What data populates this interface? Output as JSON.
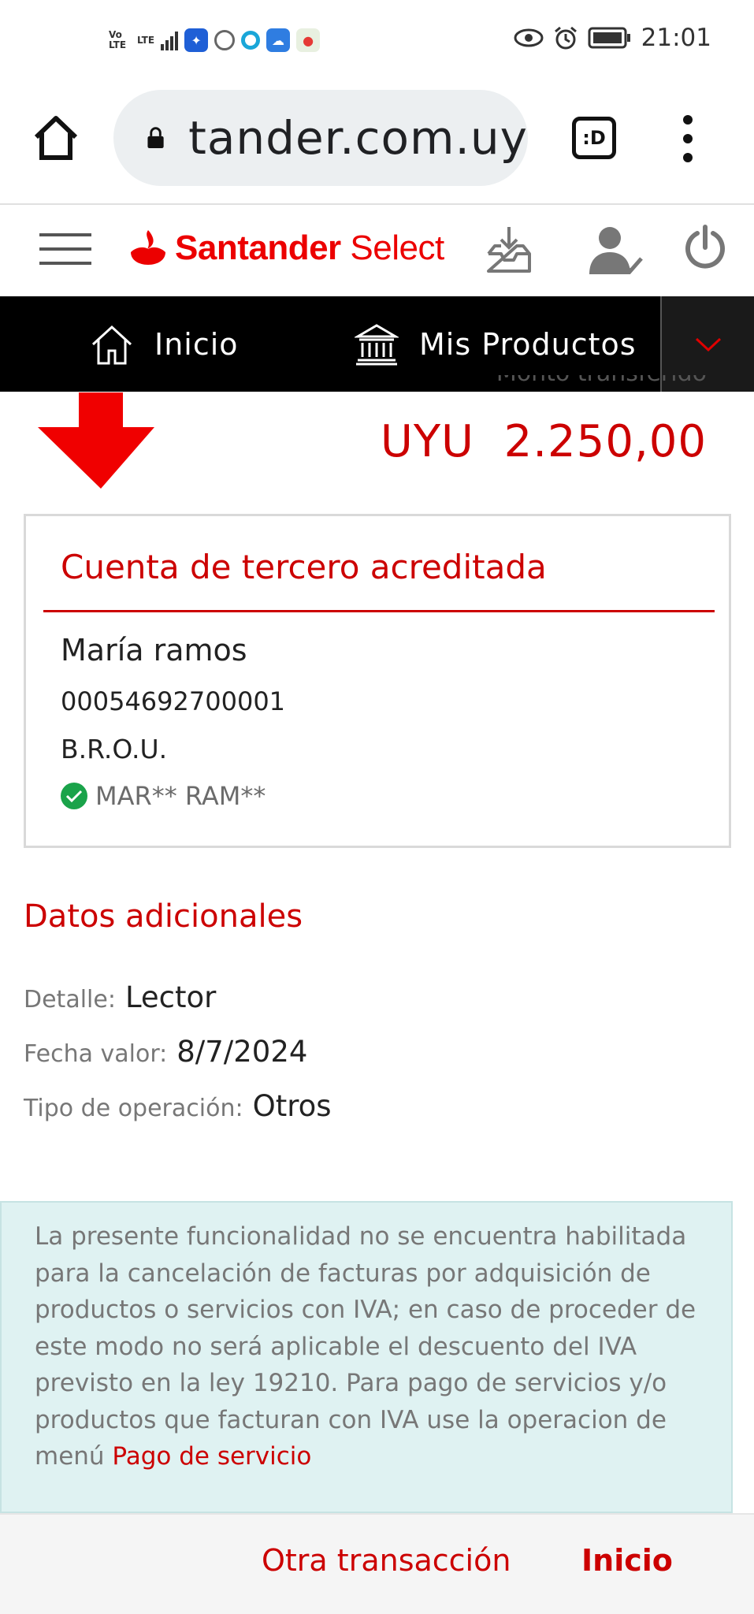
{
  "status_bar": {
    "network_1": "Vo LTE",
    "network_2": "LTE",
    "time": "21:01",
    "icons": [
      "signal-bars-icon",
      "lightbulb-app-icon",
      "camera-app-icon",
      "chat-app-icon",
      "cloud-app-icon",
      "maps-app-icon",
      "eye-icon",
      "alarm-icon",
      "battery-icon"
    ]
  },
  "browser": {
    "url": "tander.com.uy",
    "tab_label": ":D"
  },
  "header": {
    "brand_main": "Santander",
    "brand_sub": " Select",
    "brand_color": "#ec0000"
  },
  "nav": {
    "items": [
      {
        "label": "Inicio",
        "icon": "house-icon"
      },
      {
        "label": "Mis Productos",
        "icon": "bank-icon"
      }
    ]
  },
  "transfer": {
    "amount_label": "Monto transferido",
    "currency": "UYU",
    "amount": "2.250,00"
  },
  "card": {
    "title": "Cuenta de tercero acreditada",
    "name": "María ramos",
    "account": "00054692700001",
    "bank": "B.R.O.U.",
    "verified_name": "MAR** RAM**"
  },
  "additional": {
    "title": "Datos adicionales",
    "rows": [
      {
        "label": "Detalle:",
        "value": "Lector"
      },
      {
        "label": "Fecha valor:",
        "value": "8/7/2024"
      },
      {
        "label": "Tipo de operación:",
        "value": "Otros"
      }
    ]
  },
  "notice": {
    "text": "La presente funcionalidad no se encuentra habilitada para la cancelación de facturas por adquisición de productos o servicios con IVA; en caso de proceder de este modo no será aplicable el descuento del IVA previsto en la ley 19210. Para pago de servicios y/o productos que facturan con IVA use la operacion de menú ",
    "link": "Pago de servicio"
  },
  "footer": {
    "other_label": "Otra transacción",
    "home_label": "Inicio"
  }
}
